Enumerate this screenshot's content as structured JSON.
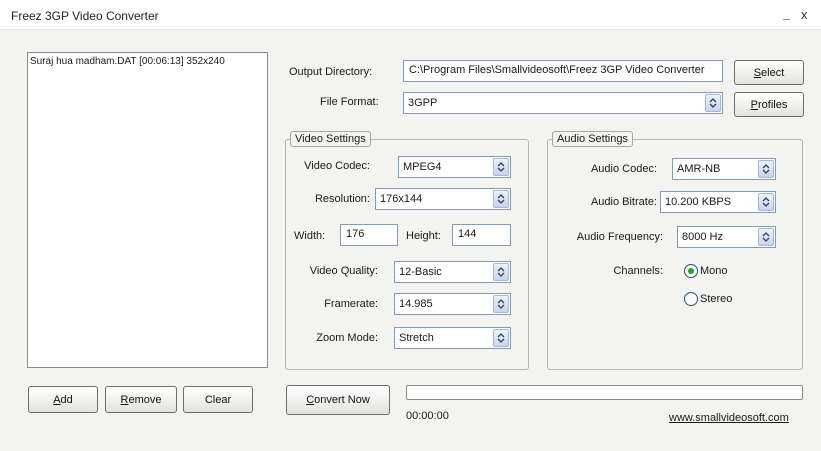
{
  "window": {
    "title": "Freez 3GP Video Converter",
    "minimize_glyph": "_",
    "close_glyph": "x"
  },
  "file_list": {
    "items": [
      "Suraj hua madham.DAT [00:06:13] 352x240"
    ]
  },
  "list_buttons": {
    "add": {
      "accel": "A",
      "rest": "dd"
    },
    "remove": {
      "accel": "R",
      "rest": "emove"
    },
    "clear": "Clear"
  },
  "output": {
    "label": "Output Directory:",
    "value": "C:\\Program Files\\Smallvideosoft\\Freez 3GP Video Converter",
    "select_button": {
      "accel": "S",
      "rest": "elect"
    }
  },
  "file_format": {
    "label": "File Format:",
    "value": "3GPP",
    "profiles_button": {
      "accel": "P",
      "rest": "rofiles"
    }
  },
  "video_settings": {
    "title": "Video Settings",
    "codec": {
      "label": "Video Codec:",
      "value": "MPEG4"
    },
    "resolution": {
      "label": "Resolution:",
      "value": "176x144"
    },
    "width": {
      "label": "Width:",
      "value": "176"
    },
    "height": {
      "label": "Height:",
      "value": "144"
    },
    "quality": {
      "label": "Video Quality:",
      "value": "12-Basic"
    },
    "framerate": {
      "label": "Framerate:",
      "value": "14.985"
    },
    "zoom": {
      "label": "Zoom Mode:",
      "value": "Stretch"
    }
  },
  "audio_settings": {
    "title": "Audio Settings",
    "codec": {
      "label": "Audio Codec:",
      "value": "AMR-NB"
    },
    "bitrate": {
      "label": "Audio Bitrate:",
      "value": "10.200 KBPS"
    },
    "frequency": {
      "label": "Audio Frequency:",
      "value": "8000 Hz"
    },
    "channels": {
      "label": "Channels:",
      "options": [
        "Mono",
        "Stereo"
      ],
      "selected": "Mono"
    }
  },
  "convert": {
    "button": {
      "accel": "C",
      "rest": "onvert Now"
    },
    "progress": 0,
    "elapsed": "00:00:00"
  },
  "footer": {
    "website": "www.smallvideosoft.com"
  },
  "colors": {
    "accent_green": "#21a121",
    "input_border": "#7f9db9"
  },
  "icons": {
    "combo_arrow": "up-down-arrows-icon"
  }
}
